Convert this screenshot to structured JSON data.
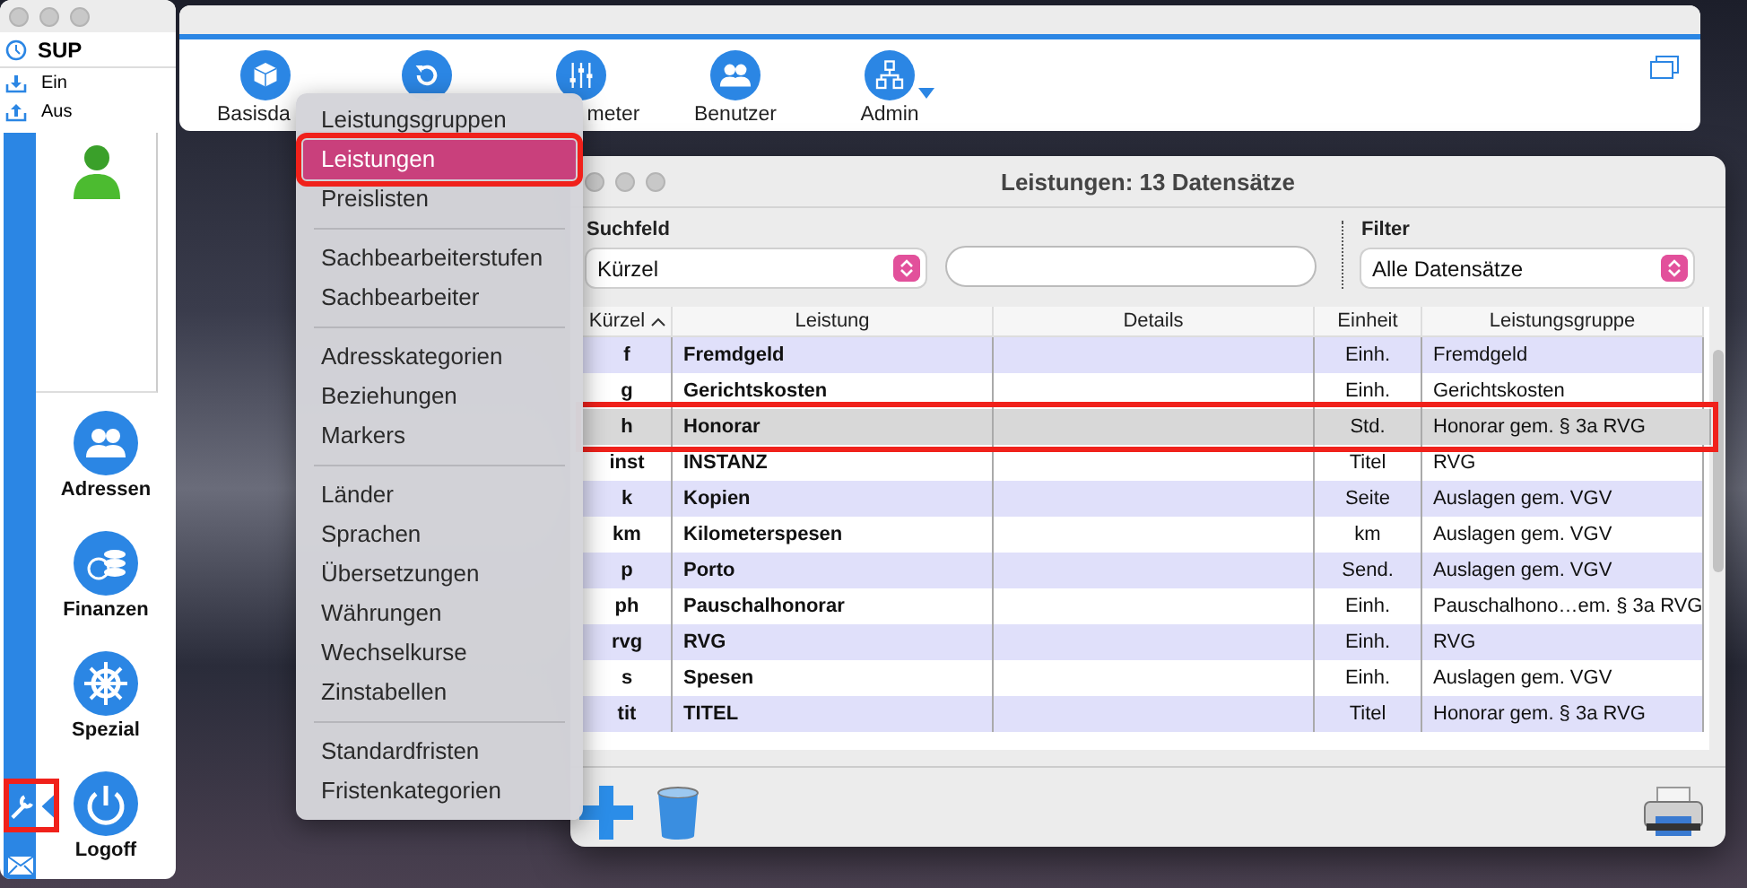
{
  "sidebar": {
    "user": "SUP",
    "actions": [
      {
        "label": "Ein"
      },
      {
        "label": "Aus"
      }
    ],
    "modules": [
      {
        "label": "Adressen"
      },
      {
        "label": "Finanzen"
      },
      {
        "label": "Spezial"
      },
      {
        "label": "Logoff"
      }
    ],
    "tools_selected": true
  },
  "toolbar": {
    "items": [
      {
        "label": "Basisda",
        "has_dropdown": false
      },
      {
        "has_dropdown": false
      },
      {
        "label": "meter",
        "has_dropdown": false
      },
      {
        "label": "Benutzer",
        "has_dropdown": false
      },
      {
        "label": "Admin",
        "has_dropdown": true
      }
    ]
  },
  "menu": {
    "groups": [
      [
        {
          "label": "Leistungsgruppen",
          "selected": false
        },
        {
          "label": "Leistungen",
          "selected": true
        },
        {
          "label": "Preislisten",
          "selected": false
        }
      ],
      [
        {
          "label": "Sachbearbeiterstufen",
          "selected": false
        },
        {
          "label": "Sachbearbeiter",
          "selected": false
        }
      ],
      [
        {
          "label": "Adresskategorien",
          "selected": false
        },
        {
          "label": "Beziehungen",
          "selected": false
        },
        {
          "label": "Markers",
          "selected": false
        }
      ],
      [
        {
          "label": "Länder",
          "selected": false
        },
        {
          "label": "Sprachen",
          "selected": false
        },
        {
          "label": "Übersetzungen",
          "selected": false
        },
        {
          "label": "Währungen",
          "selected": false
        },
        {
          "label": "Wechselkurse",
          "selected": false
        },
        {
          "label": "Zinstabellen",
          "selected": false
        }
      ],
      [
        {
          "label": "Standardfristen",
          "selected": false
        },
        {
          "label": "Fristenkategorien",
          "selected": false
        }
      ]
    ]
  },
  "window": {
    "title": "Leistungen: 13 Datensätze",
    "search": {
      "label": "Suchfeld",
      "field": "Kürzel"
    },
    "filter": {
      "label": "Filter",
      "value": "Alle Datensätze"
    },
    "table": {
      "columns": [
        {
          "label": "Kürzel",
          "sorted": true
        },
        {
          "label": "Leistung",
          "sorted": false
        },
        {
          "label": "Details",
          "sorted": false
        },
        {
          "label": "Einheit",
          "sorted": false
        },
        {
          "label": "Leistungsgruppe",
          "sorted": false
        }
      ],
      "rows": [
        {
          "cells": [
            "f",
            "Fremdgeld",
            "",
            "Einh.",
            "Fremdgeld"
          ],
          "selected": false
        },
        {
          "cells": [
            "g",
            "Gerichtskosten",
            "",
            "Einh.",
            "Gerichtskosten"
          ],
          "selected": false
        },
        {
          "cells": [
            "h",
            "Honorar",
            "",
            "Std.",
            "Honorar gem. § 3a RVG"
          ],
          "selected": true
        },
        {
          "cells": [
            "inst",
            "INSTANZ",
            "",
            "Titel",
            "RVG"
          ],
          "selected": false
        },
        {
          "cells": [
            "k",
            "Kopien",
            "",
            "Seite",
            "Auslagen gem. VGV"
          ],
          "selected": false
        },
        {
          "cells": [
            "km",
            "Kilometerspesen",
            "",
            "km",
            "Auslagen gem. VGV"
          ],
          "selected": false
        },
        {
          "cells": [
            "p",
            "Porto",
            "",
            "Send.",
            "Auslagen gem. VGV"
          ],
          "selected": false
        },
        {
          "cells": [
            "ph",
            "Pauschalhonorar",
            "",
            "Einh.",
            "Pauschalhono…em. § 3a RVG"
          ],
          "selected": false
        },
        {
          "cells": [
            "rvg",
            "RVG",
            "",
            "Einh.",
            "RVG"
          ],
          "selected": false
        },
        {
          "cells": [
            "s",
            "Spesen",
            "",
            "Einh.",
            "Auslagen gem. VGV"
          ],
          "selected": false
        },
        {
          "cells": [
            "tit",
            "TITEL",
            "",
            "Titel",
            "Honorar gem. § 3a RVG"
          ],
          "selected": false
        }
      ]
    }
  }
}
